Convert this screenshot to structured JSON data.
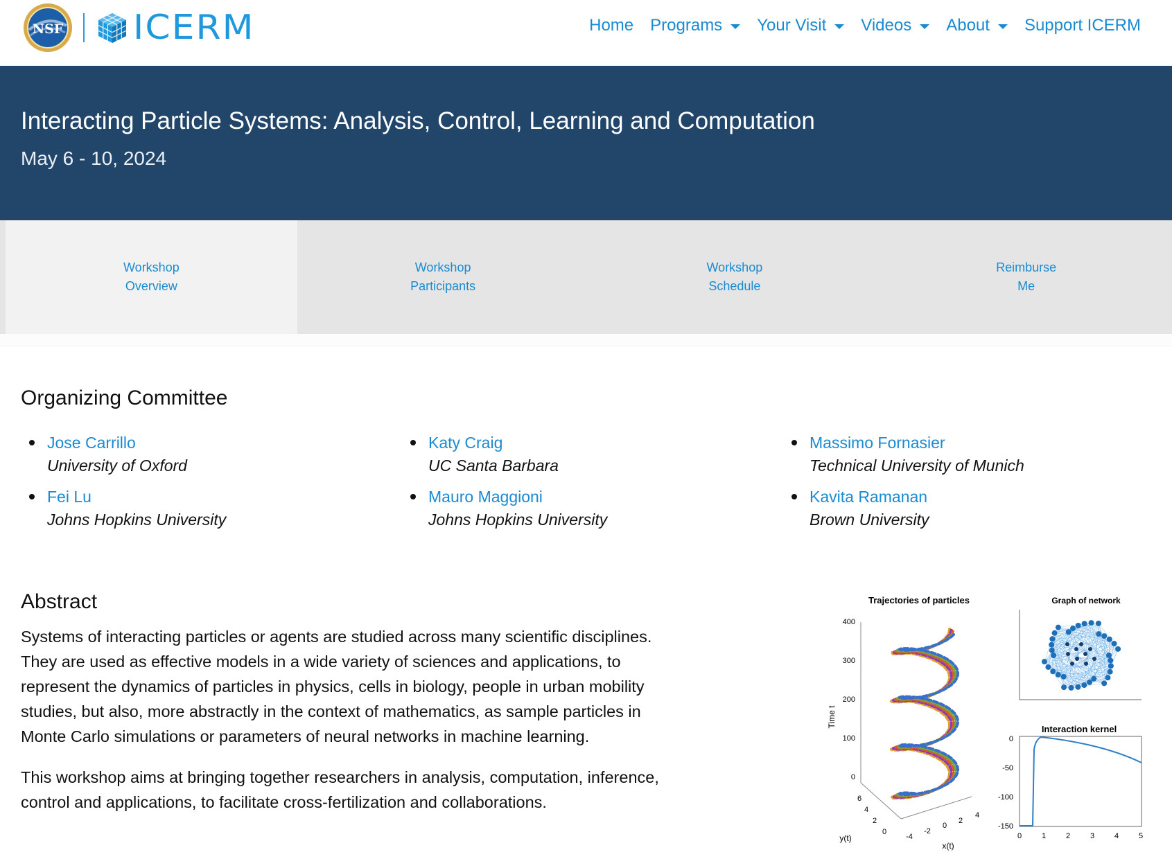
{
  "header": {
    "logos": {
      "nsf_alt": "NSF",
      "icerm_wordmark": "ICERM"
    },
    "nav": [
      {
        "label": "Home",
        "dropdown": false
      },
      {
        "label": "Programs",
        "dropdown": true
      },
      {
        "label": "Your Visit",
        "dropdown": true
      },
      {
        "label": "Videos",
        "dropdown": true
      },
      {
        "label": "About",
        "dropdown": true
      },
      {
        "label": "Support ICERM",
        "dropdown": false
      }
    ]
  },
  "hero": {
    "title": "Interacting Particle Systems: Analysis, Control, Learning and Computation",
    "date": "May 6 - 10, 2024"
  },
  "subtabs": [
    {
      "line1": "Workshop",
      "line2": "Overview",
      "active": true
    },
    {
      "line1": "Workshop",
      "line2": "Participants",
      "active": false
    },
    {
      "line1": "Workshop",
      "line2": "Schedule",
      "active": false
    },
    {
      "line1": "Reimburse",
      "line2": "Me",
      "active": false
    }
  ],
  "committee": {
    "heading": "Organizing Committee",
    "members": [
      {
        "name": "Jose Carrillo",
        "affiliation": "University of Oxford"
      },
      {
        "name": "Katy Craig",
        "affiliation": "UC Santa Barbara"
      },
      {
        "name": "Massimo Fornasier",
        "affiliation": "Technical University of Munich"
      },
      {
        "name": "Fei Lu",
        "affiliation": "Johns Hopkins University"
      },
      {
        "name": "Mauro Maggioni",
        "affiliation": "Johns Hopkins University"
      },
      {
        "name": "Kavita Ramanan",
        "affiliation": "Brown University"
      }
    ]
  },
  "abstract": {
    "heading": "Abstract",
    "paragraphs": [
      "Systems of interacting particles or agents are studied across many scientific disciplines. They are used as effective models in a wide variety of sciences and applications, to represent the dynamics of particles in physics, cells in biology, people in urban mobility studies, but also, more abstractly in the context of mathematics, as sample particles in Monte Carlo simulations or parameters of neural networks in machine learning.",
      "This workshop aims at bringing together researchers in analysis, computation, inference, control and applications, to facilitate cross-fertilization and collaborations."
    ]
  },
  "figure": {
    "panel1_title": "Trajectories of particles",
    "panel1_zlabel": "Time t",
    "panel1_ylabel": "y(t)",
    "panel1_xlabel": "x(t)",
    "panel1_zticks": [
      "400",
      "300",
      "200",
      "100",
      "0"
    ],
    "panel1_yticks": [
      "6",
      "4",
      "2",
      "0"
    ],
    "panel1_xticks": [
      "-4",
      "-2",
      "0",
      "2",
      "4"
    ],
    "panel2_title": "Graph of network",
    "panel3_title": "Interaction kernel",
    "panel3_yticks": [
      "0",
      "-50",
      "-100",
      "-150"
    ],
    "panel3_xticks": [
      "0",
      "1",
      "2",
      "3",
      "4",
      "5"
    ]
  }
}
